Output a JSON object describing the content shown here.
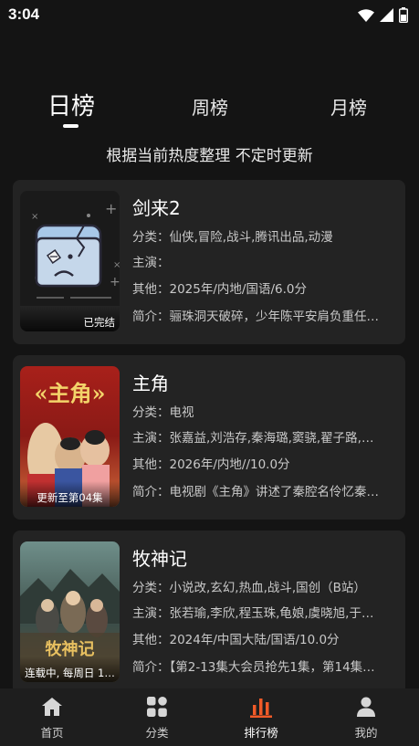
{
  "status_bar": {
    "time": "3:04"
  },
  "tabs": [
    {
      "label": "日榜",
      "active": true
    },
    {
      "label": "周榜",
      "active": false
    },
    {
      "label": "月榜",
      "active": false
    }
  ],
  "subtitle": "根据当前热度整理 不定时更新",
  "items": [
    {
      "title": "剑来2",
      "badge": "已完结",
      "category": "分类：仙侠,冒险,战斗,腾讯出品,动漫",
      "cast": "主演：",
      "other": "其他：2025年/内地/国语/6.0分",
      "intro": "简介：骊珠洞天破碎，少年陈平安肩负重任…",
      "poster": "placeholder-sad-face"
    },
    {
      "title": "主角",
      "badge": "更新至第04集",
      "category": "分类：电视",
      "cast": "主演：张嘉益,刘浩存,秦海璐,窦骁,翟子路,…",
      "other": "其他：2026年/内地//10.0分",
      "intro": "简介：电视剧《主角》讲述了秦腔名伶忆秦…",
      "poster_text": "«主角»"
    },
    {
      "title": "牧神记",
      "badge": "连载中, 每周日 1…",
      "category": "分类：小说改,玄幻,热血,战斗,国创（B站）",
      "cast": "主演：张若瑜,李欣,程玉珠,龟娘,虞晓旭,于…",
      "other": "其他：2024年/中国大陆/国语/10.0分",
      "intro": "简介：【第2-13集大会员抢先1集，第14集…",
      "poster_text": "牧神记"
    }
  ],
  "nav": [
    {
      "label": "首页",
      "icon": "home-icon",
      "active": false
    },
    {
      "label": "分类",
      "icon": "category-icon",
      "active": false
    },
    {
      "label": "排行榜",
      "icon": "rank-chart-icon",
      "active": true
    },
    {
      "label": "我的",
      "icon": "person-icon",
      "active": false
    }
  ],
  "colors": {
    "accent": "#f05a28",
    "background": "#141414",
    "card": "#232323"
  }
}
